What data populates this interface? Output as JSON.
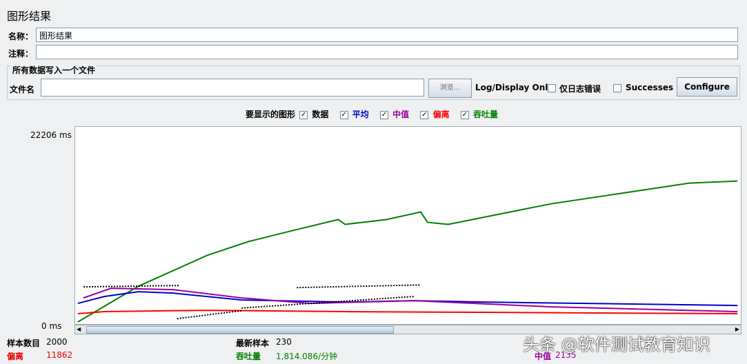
{
  "title": "图形结果",
  "name_label": "名称：",
  "name_value": "图形结果",
  "comment_label": "注释：",
  "comment_value": "",
  "file_group": {
    "title": "所有数据写入一个文件",
    "file_label": "文件名",
    "file_value": "",
    "browse": "浏览...",
    "log_display": "Log/Display Only:",
    "errors_only": "仅日志错误",
    "successes": "Successes",
    "configure": "Configure"
  },
  "graphs": {
    "label": "要显示的图形",
    "items": [
      {
        "label": "数据",
        "color": "#000000"
      },
      {
        "label": "平均",
        "color": "#0000cc"
      },
      {
        "label": "中值",
        "color": "#990099"
      },
      {
        "label": "偏离",
        "color": "#ff0000"
      },
      {
        "label": "吞吐量",
        "color": "#008000"
      }
    ]
  },
  "stats": {
    "samples_label": "样本数目",
    "samples": "2000",
    "latest_label": "最新样本",
    "latest": "230",
    "deviation_label": "偏离",
    "deviation": "11862",
    "throughput_label": "吞吐量",
    "throughput": "1,814.086/分钟",
    "median_label": "中值",
    "median": "2135"
  },
  "watermark": "头条 @软件测试教育知识",
  "chart_data": {
    "type": "line",
    "ylabel_max": "22206  ms",
    "ylabel_min": "0  ms",
    "ylim": [
      0,
      22206
    ],
    "xlim": [
      0,
      2000
    ],
    "series": [
      {
        "name": "吞吐量",
        "color": "#008000",
        "x": [
          8,
          190,
          397,
          521,
          645,
          790,
          811,
          935,
          1038,
          1059,
          1121,
          1224,
          1431,
          1638,
          1845,
          1990
        ],
        "y": [
          232,
          4257,
          7740,
          9288,
          10449,
          11765,
          11223,
          11765,
          12616,
          11455,
          11223,
          11997,
          13545,
          14706,
          15867,
          16099
        ]
      },
      {
        "name": "平均",
        "color": "#0000cc",
        "x": [
          8,
          87,
          190,
          294,
          500,
          811,
          1017,
          1224,
          1990
        ],
        "y": [
          2322,
          3096,
          3638,
          3483,
          2709,
          2477,
          2632,
          2477,
          2090
        ]
      },
      {
        "name": "中值",
        "color": "#990099",
        "x": [
          25,
          108,
          294,
          500,
          707,
          1017,
          1431,
          1990
        ],
        "y": [
          2941,
          4025,
          3870,
          2941,
          2322,
          2632,
          1935,
          1393
        ]
      },
      {
        "name": "偏离",
        "color": "#ff0000",
        "x": [
          8,
          87,
          397,
          811,
          1224,
          1990
        ],
        "y": [
          1161,
          1393,
          1548,
          1393,
          1316,
          1161
        ]
      },
      {
        "name": "数据",
        "color": "#000000",
        "segments": [
          [
            [
              25,
              4180
            ],
            [
              314,
              4340
            ]
          ],
          [
            [
              306,
              600
            ],
            [
              500,
              1500
            ]
          ],
          [
            [
              500,
              1800
            ],
            [
              1017,
              3100
            ]
          ],
          [
            [
              666,
              4100
            ],
            [
              1038,
              4400
            ]
          ]
        ]
      }
    ]
  }
}
